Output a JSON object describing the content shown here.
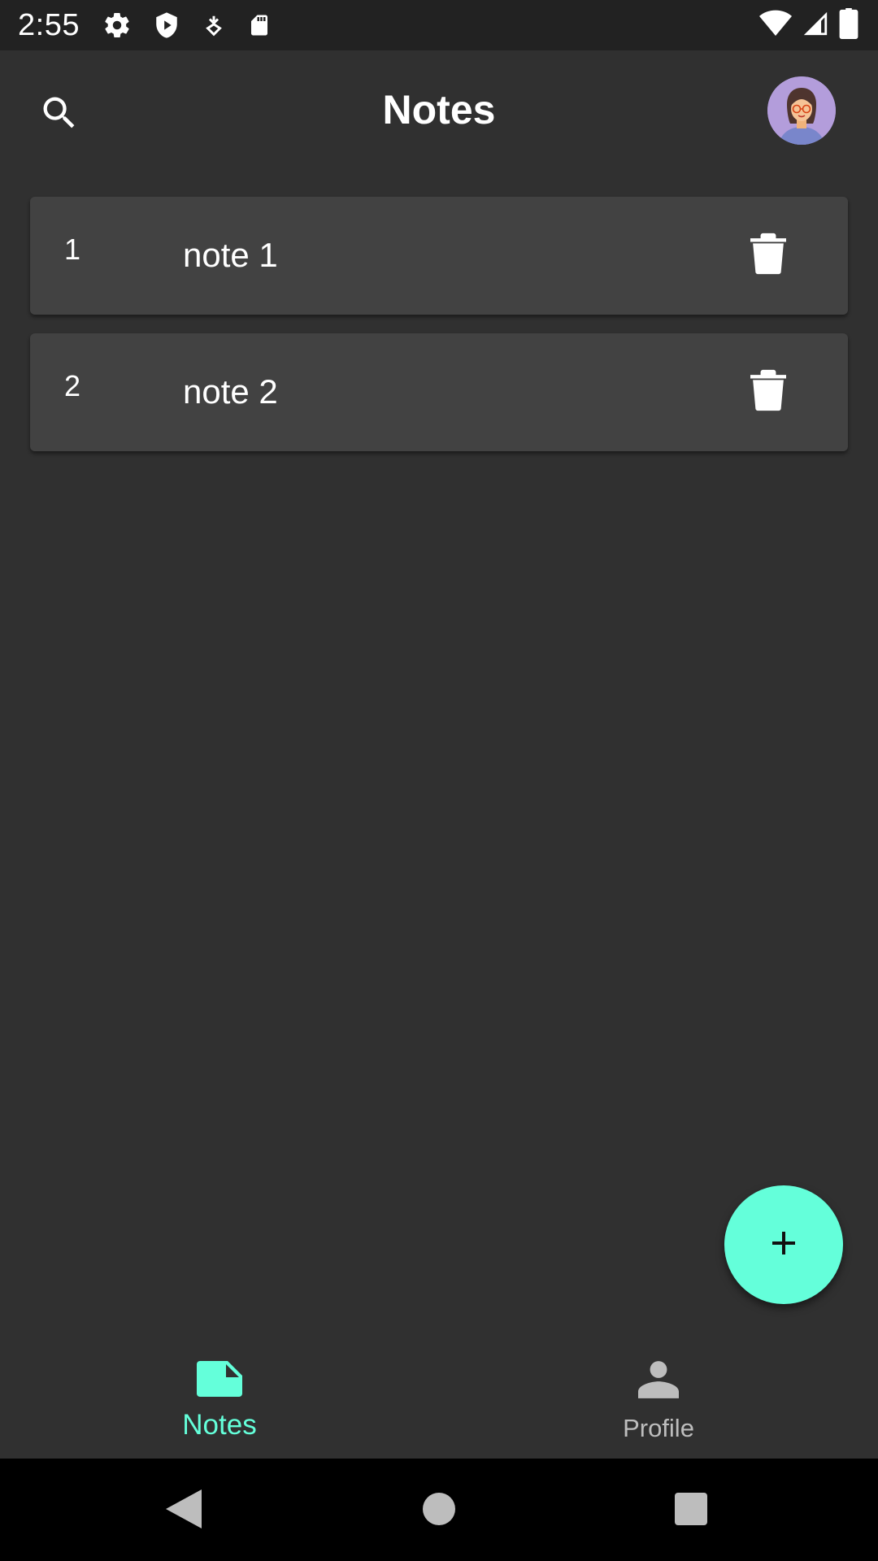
{
  "status_bar": {
    "time": "2:55",
    "left_icons": [
      "gear-icon",
      "shield-icon",
      "download-icon",
      "sd-card-icon"
    ],
    "right_icons": [
      "wifi-icon",
      "signal-icon",
      "battery-icon"
    ]
  },
  "app_bar": {
    "title": "Notes",
    "search_icon": "search-icon",
    "avatar": "avatar"
  },
  "notes": [
    {
      "id": "1",
      "title": "note 1"
    },
    {
      "id": "2",
      "title": "note 2"
    }
  ],
  "fab": {
    "icon": "plus-icon"
  },
  "bottom_nav": {
    "items": [
      {
        "label": "Notes",
        "icon": "note-icon",
        "active": true
      },
      {
        "label": "Profile",
        "icon": "person-icon",
        "active": false
      }
    ]
  },
  "colors": {
    "accent": "#64ffda",
    "background": "#303030",
    "card": "#424242",
    "status_bar": "#222222"
  }
}
